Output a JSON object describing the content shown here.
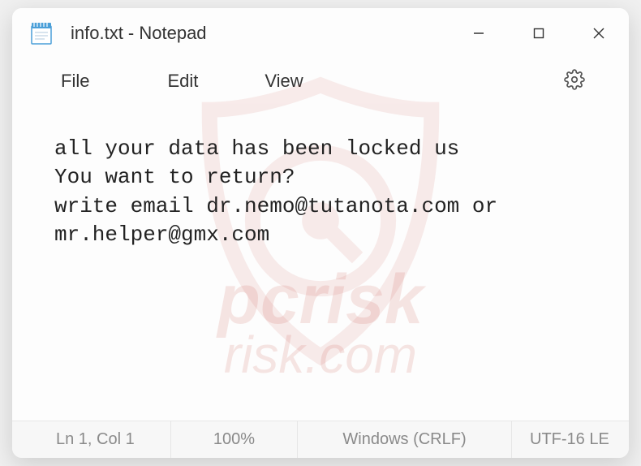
{
  "titlebar": {
    "title": "info.txt - Notepad"
  },
  "menu": {
    "file": "File",
    "edit": "Edit",
    "view": "View"
  },
  "content": {
    "text": "all your data has been locked us\nYou want to return?\nwrite email dr.nemo@tutanota.com or mr.helper@gmx.com"
  },
  "statusbar": {
    "position": "Ln 1, Col 1",
    "zoom": "100%",
    "lineending": "Windows (CRLF)",
    "encoding": "UTF-16 LE"
  },
  "watermark": {
    "line1": "pcrisk",
    "line2": "risk.com"
  }
}
